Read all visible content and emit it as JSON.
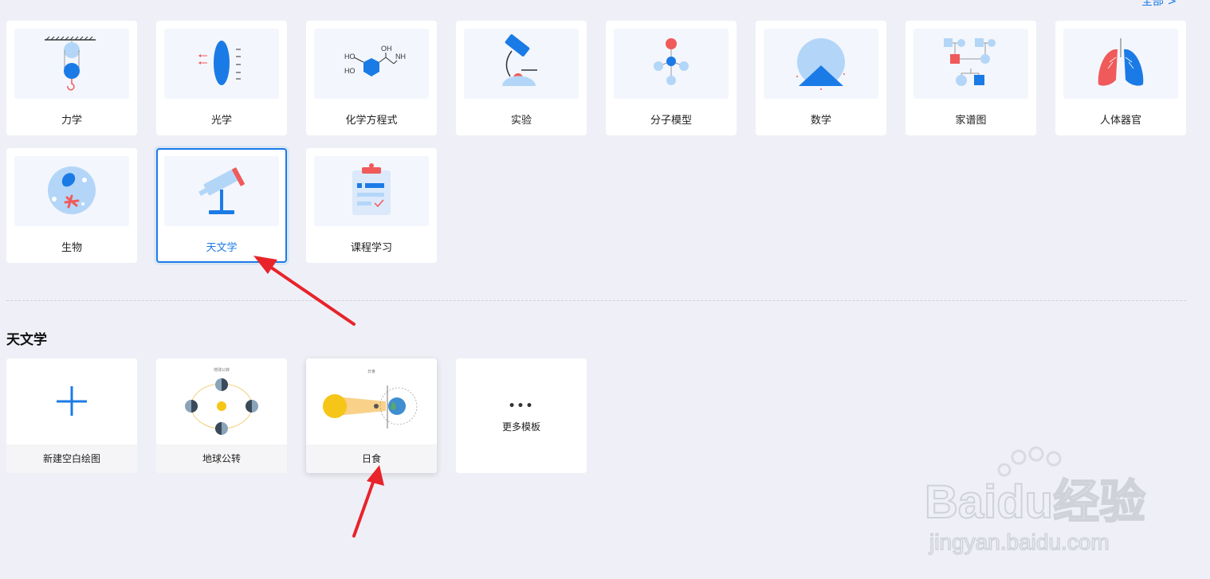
{
  "header": {
    "all_link": "全部 >"
  },
  "categories": [
    {
      "label": "力学",
      "icon": "pulley-icon"
    },
    {
      "label": "光学",
      "icon": "lens-icon"
    },
    {
      "label": "化学方程式",
      "icon": "molecule-formula-icon",
      "text_a": "HO",
      "text_b": "OH",
      "text_c": "NH",
      "text_d": "HO"
    },
    {
      "label": "实验",
      "icon": "microscope-icon"
    },
    {
      "label": "分子模型",
      "icon": "molecule-model-icon"
    },
    {
      "label": "数学",
      "icon": "geometry-icon"
    },
    {
      "label": "家谱图",
      "icon": "family-tree-icon"
    },
    {
      "label": "人体器官",
      "icon": "lungs-icon"
    },
    {
      "label": "生物",
      "icon": "cell-icon"
    },
    {
      "label": "天文学",
      "icon": "telescope-icon",
      "selected": true
    },
    {
      "label": "课程学习",
      "icon": "clipboard-icon"
    }
  ],
  "section": {
    "title": "天文学"
  },
  "templates": [
    {
      "label": "新建空白绘图",
      "icon": "plus-icon"
    },
    {
      "label": "地球公转",
      "icon": "earth-orbit-preview",
      "preview_title": "地球公转"
    },
    {
      "label": "日食",
      "icon": "solar-eclipse-preview",
      "preview_title": "日食"
    },
    {
      "label": "更多模板",
      "icon": "more-dots-icon",
      "dots": "•••"
    }
  ],
  "watermark": {
    "brand": "Baidu经验",
    "url": "jingyan.baidu.com"
  },
  "colors": {
    "accent": "#1b7be6",
    "light_blue": "#b3d6f8",
    "red": "#f05a5a",
    "bg": "#eff0f7"
  }
}
